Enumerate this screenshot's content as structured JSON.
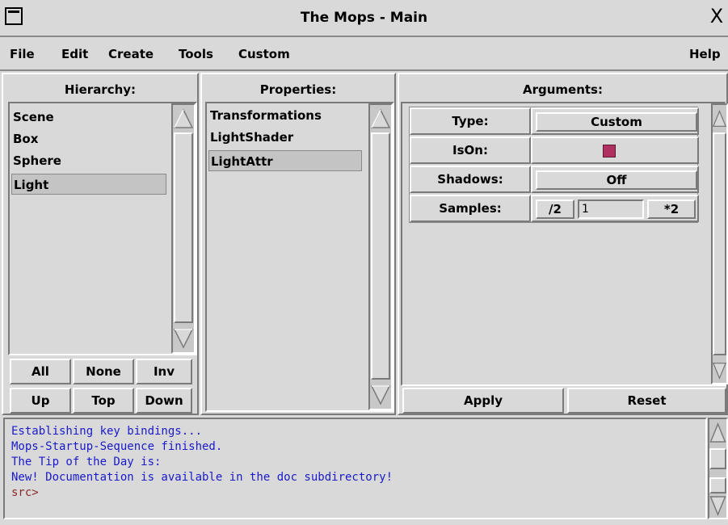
{
  "window": {
    "title": "The Mops - Main",
    "close_glyph": "X"
  },
  "menubar": {
    "items": [
      "File",
      "Edit",
      "Create",
      "Tools",
      "Custom"
    ],
    "help": "Help"
  },
  "hierarchy": {
    "header": "Hierarchy:",
    "items": [
      "Scene",
      "Box",
      "Sphere",
      "Light"
    ],
    "selected": "Light",
    "buttons": {
      "all": "All",
      "none": "None",
      "inv": "Inv",
      "up": "Up",
      "top": "Top",
      "down": "Down"
    }
  },
  "properties": {
    "header": "Properties:",
    "items": [
      "Transformations",
      "LightShader",
      "LightAttr"
    ],
    "selected": "LightAttr"
  },
  "arguments": {
    "header": "Arguments:",
    "type": {
      "label": "Type:",
      "value": "Custom"
    },
    "ison": {
      "label": "IsOn:",
      "checked": true,
      "color": "#b03060"
    },
    "shadows": {
      "label": "Shadows:",
      "value": "Off"
    },
    "samples": {
      "label": "Samples:",
      "div_label": "/2",
      "value": "1",
      "mul_label": "*2"
    },
    "apply_label": "Apply",
    "reset_label": "Reset"
  },
  "console": {
    "lines": [
      "Establishing key bindings...",
      "Mops-Startup-Sequence finished.",
      "The Tip of the Day is:",
      "New! Documentation is available in the doc subdirectory!"
    ],
    "prompt": "src>"
  },
  "colors": {
    "text_console": "#1a1acc",
    "prompt": "#8b2a2a",
    "checkbox_on": "#b03060"
  }
}
